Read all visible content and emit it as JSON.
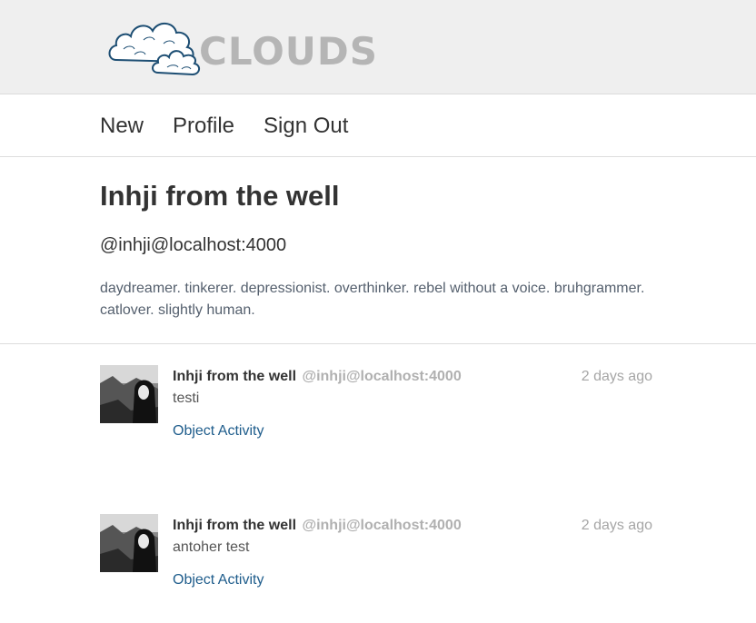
{
  "header": {
    "logo_text": "CLOUDS"
  },
  "nav": {
    "items": [
      {
        "label": "New"
      },
      {
        "label": "Profile"
      },
      {
        "label": "Sign Out"
      }
    ]
  },
  "profile": {
    "name": "Inhji from the well",
    "handle": "@inhji@localhost:4000",
    "bio": "daydreamer. tinkerer. depressionist. overthinker. rebel without a voice. bruhgrammer. catlover. slightly human."
  },
  "posts": [
    {
      "author": "Inhji from the well",
      "account": "@inhji@localhost:4000",
      "time": "2 days ago",
      "content": "testi",
      "link": "Object Activity"
    },
    {
      "author": "Inhji from the well",
      "account": "@inhji@localhost:4000",
      "time": "2 days ago",
      "content": "antoher test",
      "link": "Object Activity"
    }
  ],
  "colors": {
    "header_bg": "#efefef",
    "logo_text": "#b5b5b5",
    "cloud_stroke": "#1d4e73",
    "link": "#1f5d8c",
    "muted": "#a6a6a6"
  }
}
